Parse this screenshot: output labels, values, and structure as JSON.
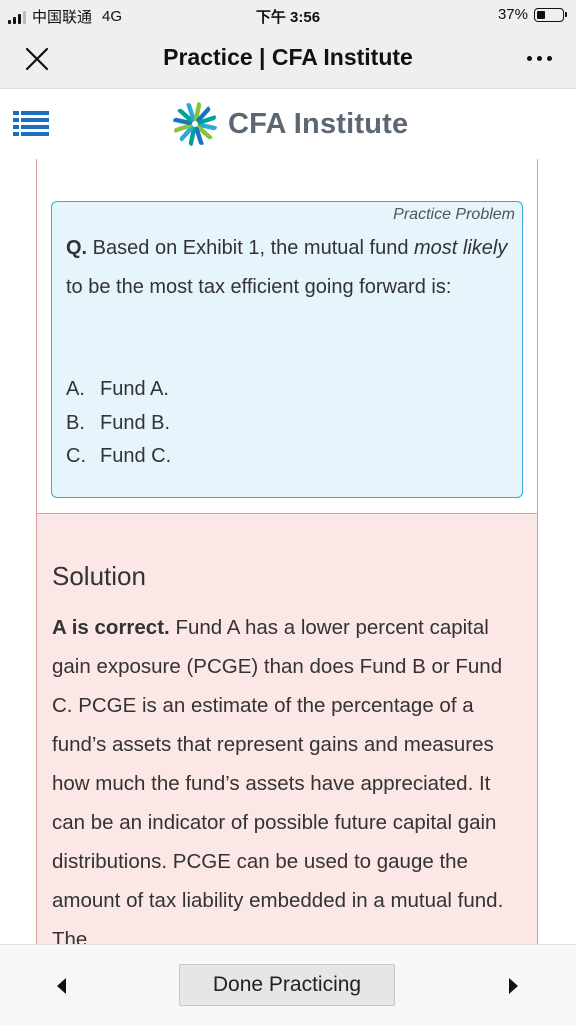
{
  "status_bar": {
    "carrier": "中国联通",
    "network": "4G",
    "time": "下午 3:56",
    "battery": "37%",
    "battery_level": 0.37
  },
  "title_bar": {
    "title": "Practice | CFA Institute",
    "close_icon": "close-icon",
    "more_icon": "more-icon"
  },
  "header": {
    "menu_icon": "menu-icon",
    "logo_text": "CFA Institute",
    "logo_colors": [
      "#2fa8d7",
      "#86c440",
      "#1b75bb",
      "#00a19a"
    ]
  },
  "question": {
    "tag": "Practice Problem",
    "label": "Q.",
    "text_1": " Based on Exhibit 1, the mutual fund ",
    "text_em_1": "most likely",
    "text_2": " to be the most tax efficient going forward is:",
    "options": [
      {
        "letter": "A.",
        "text": "Fund A."
      },
      {
        "letter": "B.",
        "text": "Fund B."
      },
      {
        "letter": "C.",
        "text": "Fund C."
      }
    ]
  },
  "solution": {
    "heading": "Solution",
    "lead": "A is correct.",
    "body": " Fund A has a lower percent capital gain exposure (PCGE) than does Fund B or Fund C. PCGE is an estimate of the percentage of a fund’s assets that represent gains and measures how much the fund’s assets have appreciated. It can be an indicator of possible future capital gain distributions. PCGE can be used to gauge the amount of tax liability embedded in a mutual fund. The"
  },
  "bottom_bar": {
    "prev_icon": "prev-arrow-icon",
    "next_icon": "next-arrow-icon",
    "done_label": "Done Practicing"
  },
  "colors": {
    "question_bg": "#e6f5fb",
    "question_border": "#39a9de",
    "solution_bg": "#fbe7e6",
    "solution_border": "#d9a0a0",
    "menu_icon": "#1f6fc0"
  }
}
